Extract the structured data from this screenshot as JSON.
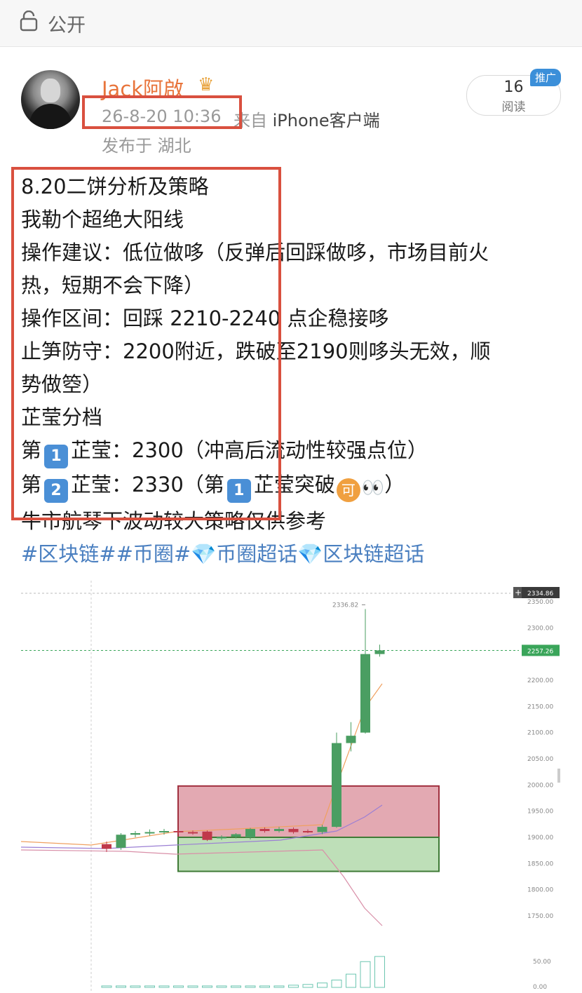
{
  "topbar": {
    "visibility_label": "公开",
    "icon": "lock-icon"
  },
  "post": {
    "author": "Jack阿啟",
    "badge_icon": "crown-icon",
    "time": "26-8-20 10:36",
    "source_prefix": "来自",
    "source": "iPhone客户端",
    "location": "发布于 湖北",
    "reads_count": "16",
    "reads_label": "阅读",
    "promo_label": "推广",
    "lines": {
      "l1": "8.20二饼分析及策略",
      "l2": "我勒个超绝大阳线",
      "l3": "操作建议：低位做哆（反弹后回踩做哆，市场目前火",
      "l4": "热，短期不会下降）",
      "l5": "操作区间：回踩 2210-2240 点企稳接哆",
      "l6": "止笋防守：2200附近，跌破至2190则哆头无效，顺",
      "l7": "势做箜）",
      "l8": "芷莹分档",
      "l9a": "第",
      "l9n": "1",
      "l9b": "芷莹：2300（冲高后流动性较强点位）",
      "l10a": "第",
      "l10n": "2",
      "l10b": "芷莹：2330（第",
      "l10n2": "1",
      "l10c": "芷莹突破",
      "l10ke": "可",
      "l10eyes": "👀",
      "l10d": "）",
      "l11": "牛市航琴下波动较大策略仅供参考",
      "hashtags": "#区块链##币圈#💎币圈超话💎区块链超话"
    }
  },
  "chart_data": {
    "type": "candlestick",
    "y_ticks": [
      "2350.00",
      "2300.00",
      "2250.00",
      "2200.00",
      "2150.00",
      "2100.00",
      "2050.00",
      "2000.00",
      "1950.00",
      "1900.00",
      "1850.00",
      "1800.00",
      "1750.00"
    ],
    "high_label": "2336.82",
    "price_tags": [
      "2334.86",
      "2257.26"
    ],
    "volume_tick": "50.00",
    "volume_tick2": "0.00",
    "zones": [
      {
        "name": "resistance-zone",
        "from": 1900,
        "to": 1998,
        "color": "#d98c98"
      },
      {
        "name": "support-zone",
        "from": 1835,
        "to": 1900,
        "color": "#a8d4a0"
      }
    ],
    "candles": [
      {
        "o": 1887,
        "c": 1878,
        "h": 1892,
        "l": 1872
      },
      {
        "o": 1880,
        "c": 1905,
        "h": 1908,
        "l": 1876
      },
      {
        "o": 1905,
        "c": 1908,
        "h": 1912,
        "l": 1900
      },
      {
        "o": 1908,
        "c": 1910,
        "h": 1915,
        "l": 1903
      },
      {
        "o": 1910,
        "c": 1912,
        "h": 1916,
        "l": 1905
      },
      {
        "o": 1912,
        "c": 1910,
        "h": 1914,
        "l": 1906
      },
      {
        "o": 1910,
        "c": 1909,
        "h": 1913,
        "l": 1905
      },
      {
        "o": 1911,
        "c": 1895,
        "h": 1913,
        "l": 1893
      },
      {
        "o": 1898,
        "c": 1901,
        "h": 1904,
        "l": 1895
      },
      {
        "o": 1901,
        "c": 1906,
        "h": 1908,
        "l": 1898
      },
      {
        "o": 1900,
        "c": 1916,
        "h": 1918,
        "l": 1896
      },
      {
        "o": 1916,
        "c": 1912,
        "h": 1919,
        "l": 1909
      },
      {
        "o": 1912,
        "c": 1916,
        "h": 1920,
        "l": 1909
      },
      {
        "o": 1916,
        "c": 1910,
        "h": 1919,
        "l": 1907
      },
      {
        "o": 1912,
        "c": 1911,
        "h": 1915,
        "l": 1908
      },
      {
        "o": 1910,
        "c": 1920,
        "h": 1924,
        "l": 1906
      },
      {
        "o": 1920,
        "c": 2080,
        "h": 2100,
        "l": 1918
      },
      {
        "o": 2080,
        "c": 2094,
        "h": 2120,
        "l": 2064
      },
      {
        "o": 2100,
        "c": 2250,
        "h": 2336,
        "l": 2098
      },
      {
        "o": 2250,
        "c": 2257,
        "h": 2268,
        "l": 2245
      }
    ],
    "volumes": [
      2,
      2,
      2,
      2,
      2,
      2,
      2,
      2,
      2,
      2,
      2,
      2,
      2,
      3,
      4,
      6,
      10,
      18,
      35,
      42
    ]
  }
}
